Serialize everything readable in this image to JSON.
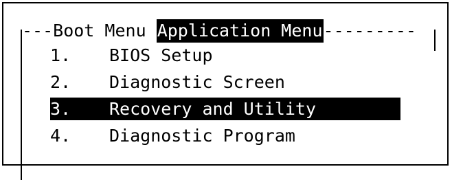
{
  "boot_screen": {
    "title_left_dashes": "---",
    "tabs": [
      {
        "label": "Boot Menu",
        "active": false
      },
      {
        "label": "Application Menu",
        "active": true
      }
    ],
    "title_right_dashes": "---------",
    "items": [
      {
        "number": "1.",
        "label": "BIOS Setup",
        "selected": false
      },
      {
        "number": "2.",
        "label": "Diagnostic Screen",
        "selected": false
      },
      {
        "number": "3.",
        "label": "Recovery and Utility",
        "selected": true
      },
      {
        "number": "4.",
        "label": "Diagnostic Program",
        "selected": false
      }
    ],
    "colors": {
      "background": "#ffffff",
      "foreground": "#000000",
      "highlight_background": "#000000",
      "highlight_foreground": "#ffffff"
    }
  }
}
